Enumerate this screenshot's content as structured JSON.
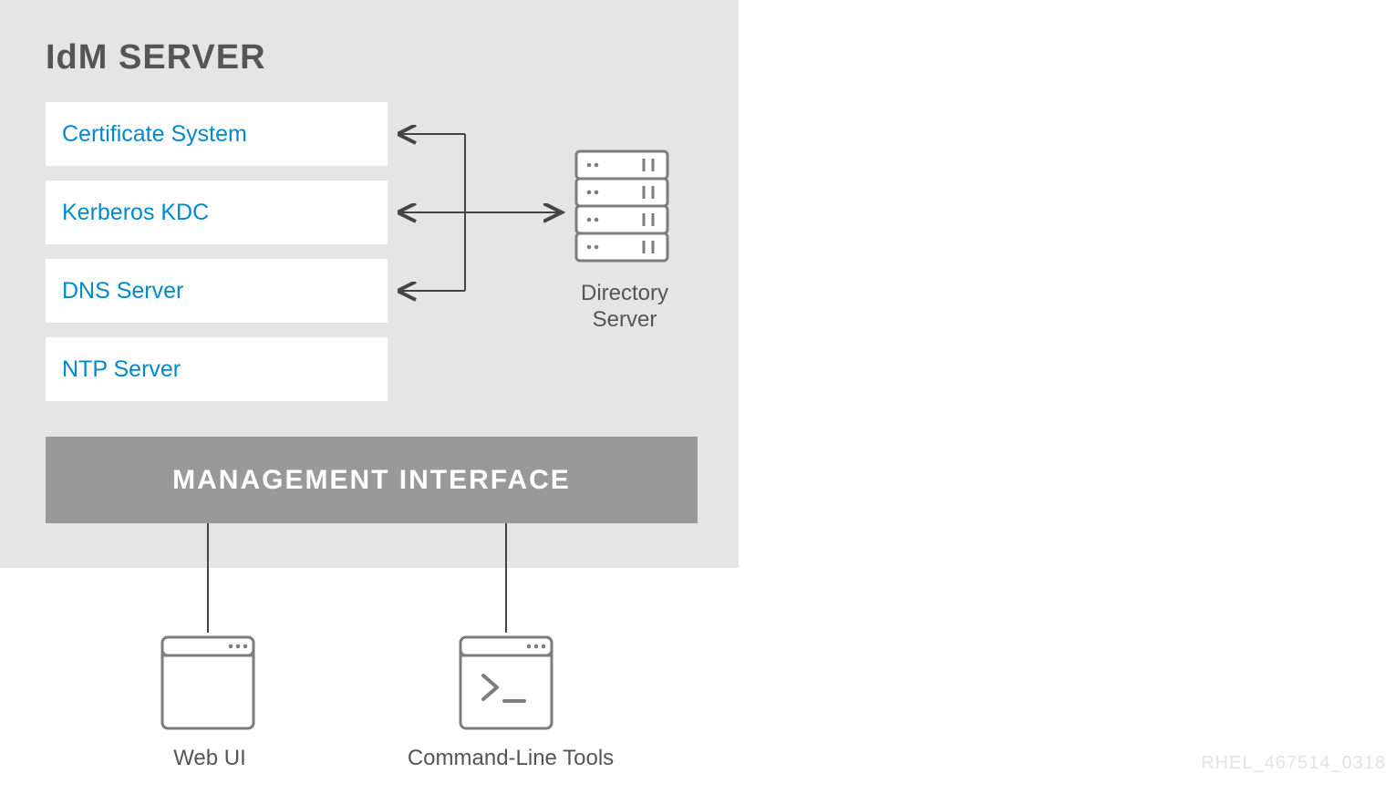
{
  "title": "IdM SERVER",
  "services": {
    "s1": "Certificate System",
    "s2": "Kerberos KDC",
    "s3": "DNS Server",
    "s4": "NTP Server"
  },
  "management_bar": "MANAGEMENT INTERFACE",
  "directory_server_line1": "Directory",
  "directory_server_line2": "Server",
  "tools": {
    "web_ui": "Web UI",
    "cli": "Command-Line Tools"
  },
  "watermark": "RHEL_467514_0318"
}
